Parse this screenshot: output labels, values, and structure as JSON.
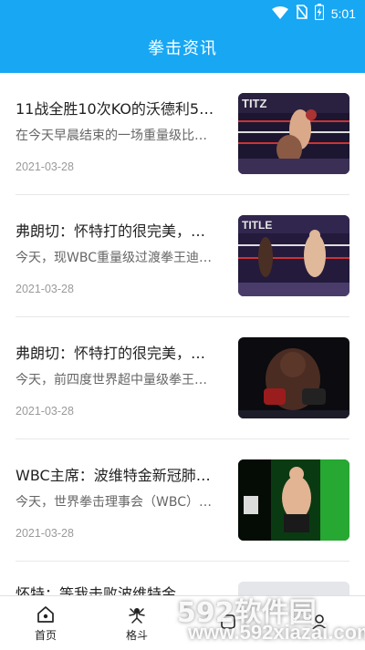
{
  "status_bar": {
    "time": "5:01",
    "icons": [
      "wifi-icon",
      "no-sim-icon",
      "battery-charging-icon"
    ]
  },
  "app_bar": {
    "title": "拳击资讯"
  },
  "theme": {
    "accent": "#17a7f3"
  },
  "news": [
    {
      "headline": "11战全胜10次KO的沃德利5…",
      "summary": "在今天早晨结束的一场重量级比…",
      "date": "2021-03-28"
    },
    {
      "headline": "弗朗切：怀特打的很完美，…",
      "summary": "今天，现WBC重量级过渡拳王迪…",
      "date": "2021-03-28"
    },
    {
      "headline": "弗朗切：怀特打的很完美，…",
      "summary": "今天，前四度世界超中量级拳王…",
      "date": "2021-03-28"
    },
    {
      "headline": "WBC主席：波维特金新冠肺…",
      "summary": "今天，世界拳击理事会（WBC）…",
      "date": "2021-03-28"
    },
    {
      "headline": "怀特：等我击败波维特金，…"
    }
  ],
  "tabs": [
    {
      "label": "首页",
      "icon": "home-icon"
    },
    {
      "label": "格斗",
      "icon": "fight-icon"
    },
    {
      "label": "",
      "icon": "icon"
    },
    {
      "label": "",
      "icon": "icon"
    }
  ],
  "watermark": {
    "title": "592软件园",
    "url": "www.592xiazai.com"
  }
}
